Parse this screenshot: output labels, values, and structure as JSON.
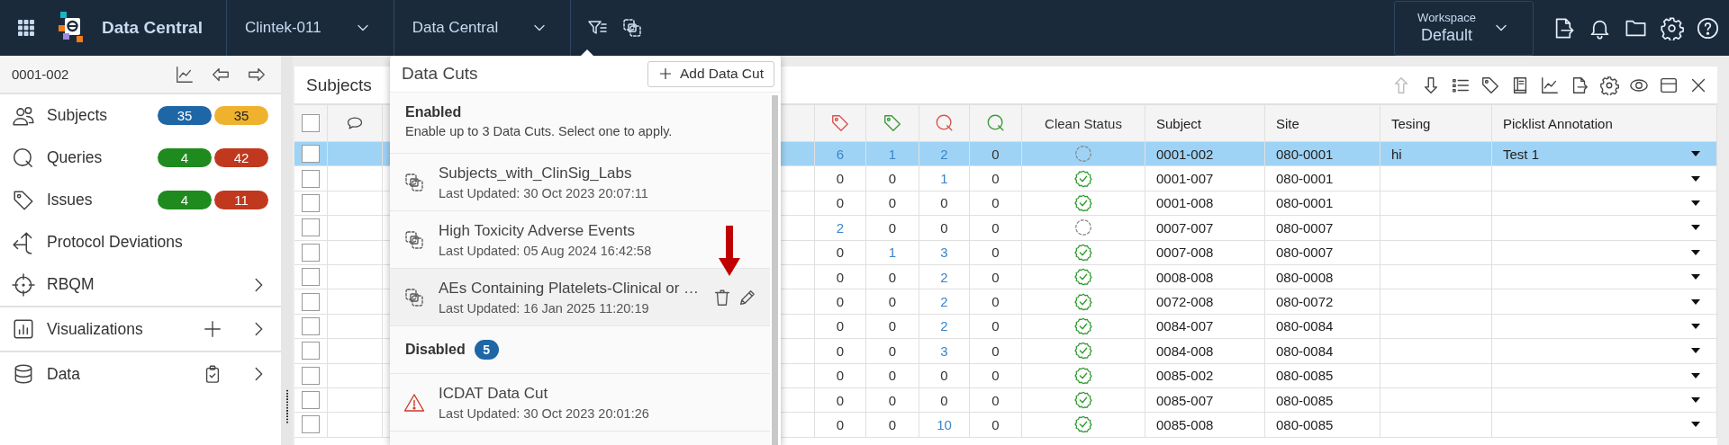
{
  "app": {
    "title": "Data Central"
  },
  "nav_dropdowns": [
    {
      "label": "Clintek-011"
    },
    {
      "label": "Data Central"
    }
  ],
  "workspace": {
    "label": "Workspace",
    "value": "Default"
  },
  "sidebar": {
    "subject_id": "0001-002",
    "items": [
      {
        "label": "Subjects",
        "kind": "badges",
        "badges": [
          {
            "text": "35",
            "color": "#1e66a6"
          },
          {
            "text": "35",
            "color": "#efb22e"
          }
        ]
      },
      {
        "label": "Queries",
        "kind": "badges",
        "badges": [
          {
            "text": "4",
            "color": "#1f8b1f"
          },
          {
            "text": "42",
            "color": "#c0391f"
          }
        ]
      },
      {
        "label": "Issues",
        "kind": "badges",
        "badges": [
          {
            "text": "4",
            "color": "#1f8b1f"
          },
          {
            "text": "11",
            "color": "#c0391f"
          }
        ]
      },
      {
        "label": "Protocol Deviations",
        "kind": "plain"
      },
      {
        "label": "RBQM",
        "kind": "submenu"
      },
      {
        "label": "Visualizations",
        "kind": "add-submenu"
      },
      {
        "label": "Data",
        "kind": "review-submenu"
      }
    ]
  },
  "panel": {
    "title": "Subjects",
    "toolbar": [
      {
        "disabled": true
      },
      {
        "disabled": false
      },
      {
        "disabled": false
      },
      {
        "disabled": false
      },
      {
        "disabled": false
      },
      {
        "disabled": false
      },
      {
        "disabled": false
      },
      {
        "disabled": false
      },
      {
        "disabled": false
      },
      {
        "disabled": false
      },
      {
        "disabled": false
      }
    ]
  },
  "table": {
    "select_all_checked": false,
    "columns": [
      {
        "kind": "tag",
        "color": "#d9534f"
      },
      {
        "kind": "tag",
        "color": "#3a9b3a"
      },
      {
        "kind": "query",
        "color": "#d9534f"
      },
      {
        "kind": "query",
        "color": "#3a9b3a"
      },
      {
        "kind": "text",
        "label": "Clean Status"
      },
      {
        "kind": "text",
        "label": "Subject"
      },
      {
        "kind": "text",
        "label": "Site"
      },
      {
        "kind": "text",
        "label": "Tesing"
      },
      {
        "kind": "text",
        "label": "Picklist Annotation"
      }
    ],
    "rows": [
      {
        "selected": true,
        "checked": false,
        "counts": [
          "6",
          "1",
          "2",
          "0"
        ],
        "clean": false,
        "subject": "0001-002",
        "site": "080-0001",
        "tesing": "hi",
        "picklist": "Test 1"
      },
      {
        "selected": false,
        "checked": false,
        "counts": [
          "0",
          "0",
          "1",
          "0"
        ],
        "clean": true,
        "subject": "0001-007",
        "site": "080-0001"
      },
      {
        "selected": false,
        "checked": false,
        "counts": [
          "0",
          "0",
          "0",
          "0"
        ],
        "clean": true,
        "subject": "0001-008",
        "site": "080-0001"
      },
      {
        "selected": false,
        "checked": false,
        "counts": [
          "2",
          "0",
          "0",
          "0"
        ],
        "clean": false,
        "subject": "0007-007",
        "site": "080-0007"
      },
      {
        "selected": false,
        "checked": false,
        "counts": [
          "0",
          "1",
          "3",
          "0"
        ],
        "clean": true,
        "subject": "0007-008",
        "site": "080-0007"
      },
      {
        "selected": false,
        "checked": false,
        "counts": [
          "0",
          "0",
          "2",
          "0"
        ],
        "clean": true,
        "subject": "0008-008",
        "site": "080-0008"
      },
      {
        "selected": false,
        "checked": false,
        "counts": [
          "0",
          "0",
          "2",
          "0"
        ],
        "clean": true,
        "subject": "0072-008",
        "site": "080-0072"
      },
      {
        "selected": false,
        "checked": false,
        "counts": [
          "0",
          "0",
          "2",
          "0"
        ],
        "clean": true,
        "subject": "0084-007",
        "site": "080-0084"
      },
      {
        "selected": false,
        "checked": false,
        "counts": [
          "0",
          "0",
          "3",
          "0"
        ],
        "clean": true,
        "subject": "0084-008",
        "site": "080-0084"
      },
      {
        "selected": false,
        "checked": false,
        "counts": [
          "0",
          "0",
          "0",
          "0"
        ],
        "clean": true,
        "subject": "0085-002",
        "site": "080-0085"
      },
      {
        "selected": false,
        "checked": false,
        "counts": [
          "0",
          "0",
          "0",
          "0"
        ],
        "clean": true,
        "subject": "0085-007",
        "site": "080-0085"
      },
      {
        "selected": false,
        "checked": false,
        "counts": [
          "0",
          "0",
          "10",
          "0"
        ],
        "clean": true,
        "subject": "0085-008",
        "site": "080-0085"
      }
    ]
  },
  "data_cuts": {
    "title": "Data Cuts",
    "add_button": "Add Data Cut",
    "sections": [
      {
        "title": "Enabled",
        "subtitle": "Enable up to 3 Data Cuts. Select one to apply.",
        "items": [
          {
            "name": "Subjects_with_ClinSig_Labs",
            "updated": "Last Updated: 30 Oct 2023 20:07:11",
            "kind": "cut",
            "hovered": false
          },
          {
            "name": "High Toxicity Adverse Events",
            "updated": "Last Updated: 05 Aug 2024 16:42:58",
            "kind": "cut",
            "hovered": false
          },
          {
            "name": "AEs Containing Platelets-Clinical or …",
            "updated": "Last Updated: 16 Jan 2025 11:20:19",
            "kind": "cut",
            "hovered": true
          }
        ]
      },
      {
        "title": "Disabled",
        "count": "5",
        "items": [
          {
            "name": "ICDAT Data Cut",
            "updated": "Last Updated: 30 Oct 2023 20:01:26",
            "kind": "warning",
            "hovered": false
          }
        ]
      }
    ]
  }
}
